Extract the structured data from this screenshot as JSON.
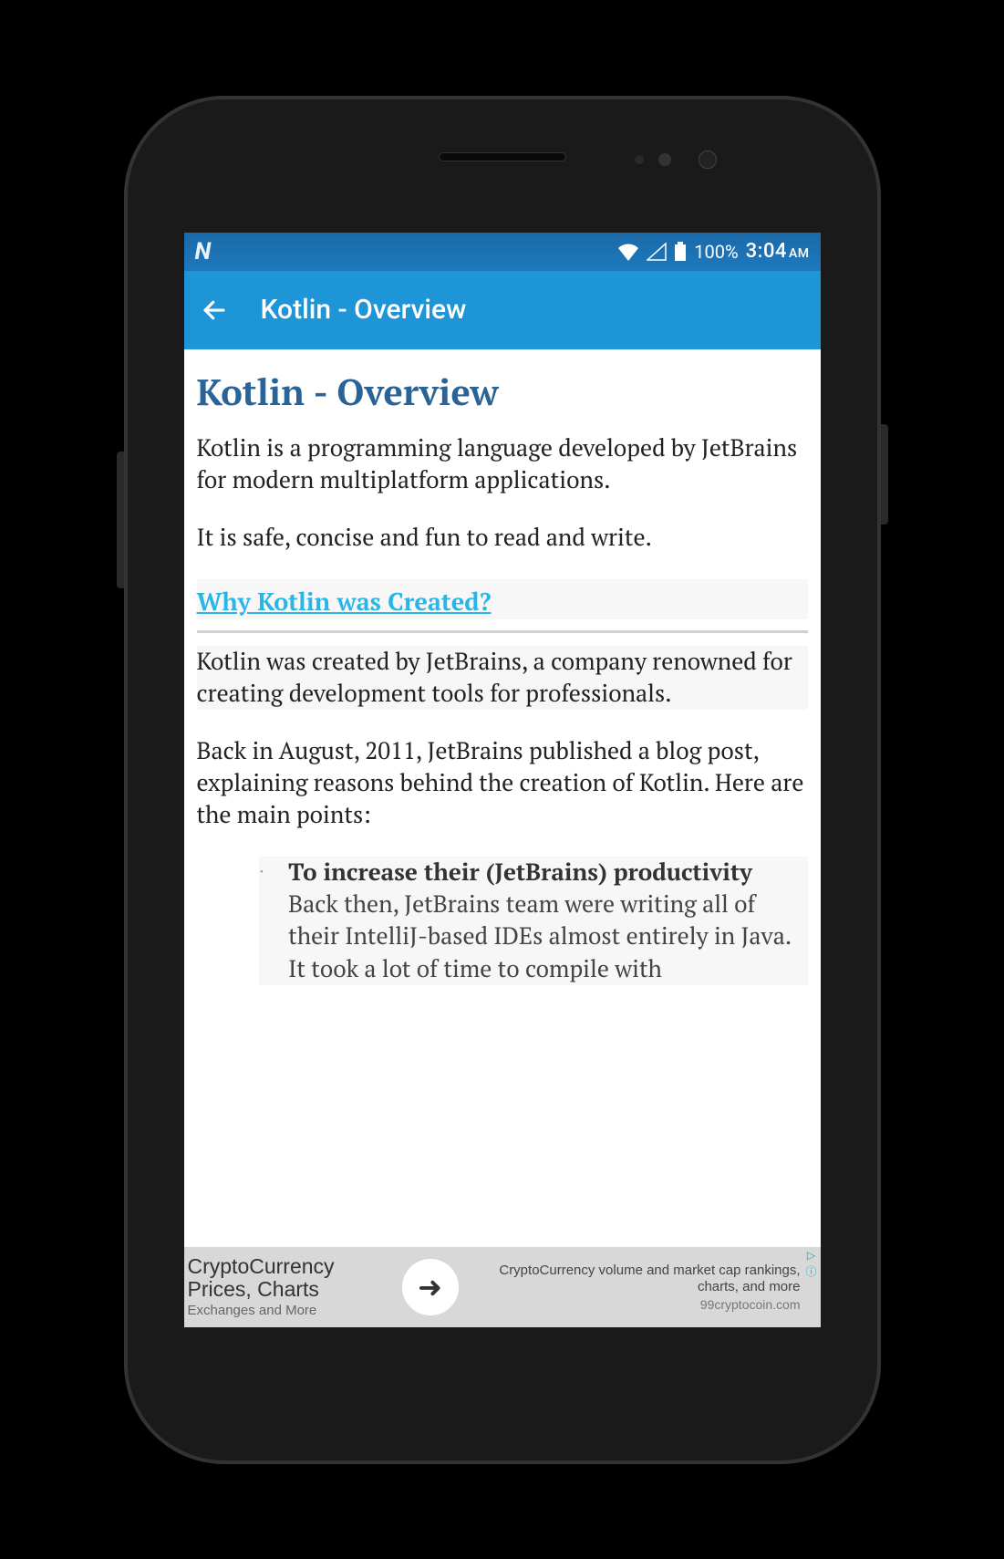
{
  "statusBar": {
    "battery_pct": "100%",
    "time": "3:04",
    "time_ampm": "AM"
  },
  "appBar": {
    "title": "Kotlin - Overview"
  },
  "content": {
    "heading": "Kotlin - Overview",
    "para1": "Kotlin is a programming language developed by JetBrains for modern multiplatform applications.",
    "para2": "It is safe, concise and fun to read and write.",
    "subheading": "Why Kotlin was Created?",
    "para3": "Kotlin was created by JetBrains, a company renowned for creating development tools for professionals.",
    "para4": "Back in August, 2011, JetBrains published a blog post, explaining reasons behind the creation of Kotlin. Here are the main points:",
    "bullet1_title": "To increase their (JetBrains) productivity",
    "bullet1_body": "Back then, JetBrains team were writing all of their IntelliJ-based IDEs almost entirely in Java. It took a lot of time to compile with"
  },
  "ad": {
    "left_title": "CryptoCurrency Prices, Charts",
    "left_sub": "Exchanges and More",
    "right_text": "CryptoCurrency volume and market cap rankings, charts, and more",
    "right_domain": "99cryptocoin.com"
  }
}
